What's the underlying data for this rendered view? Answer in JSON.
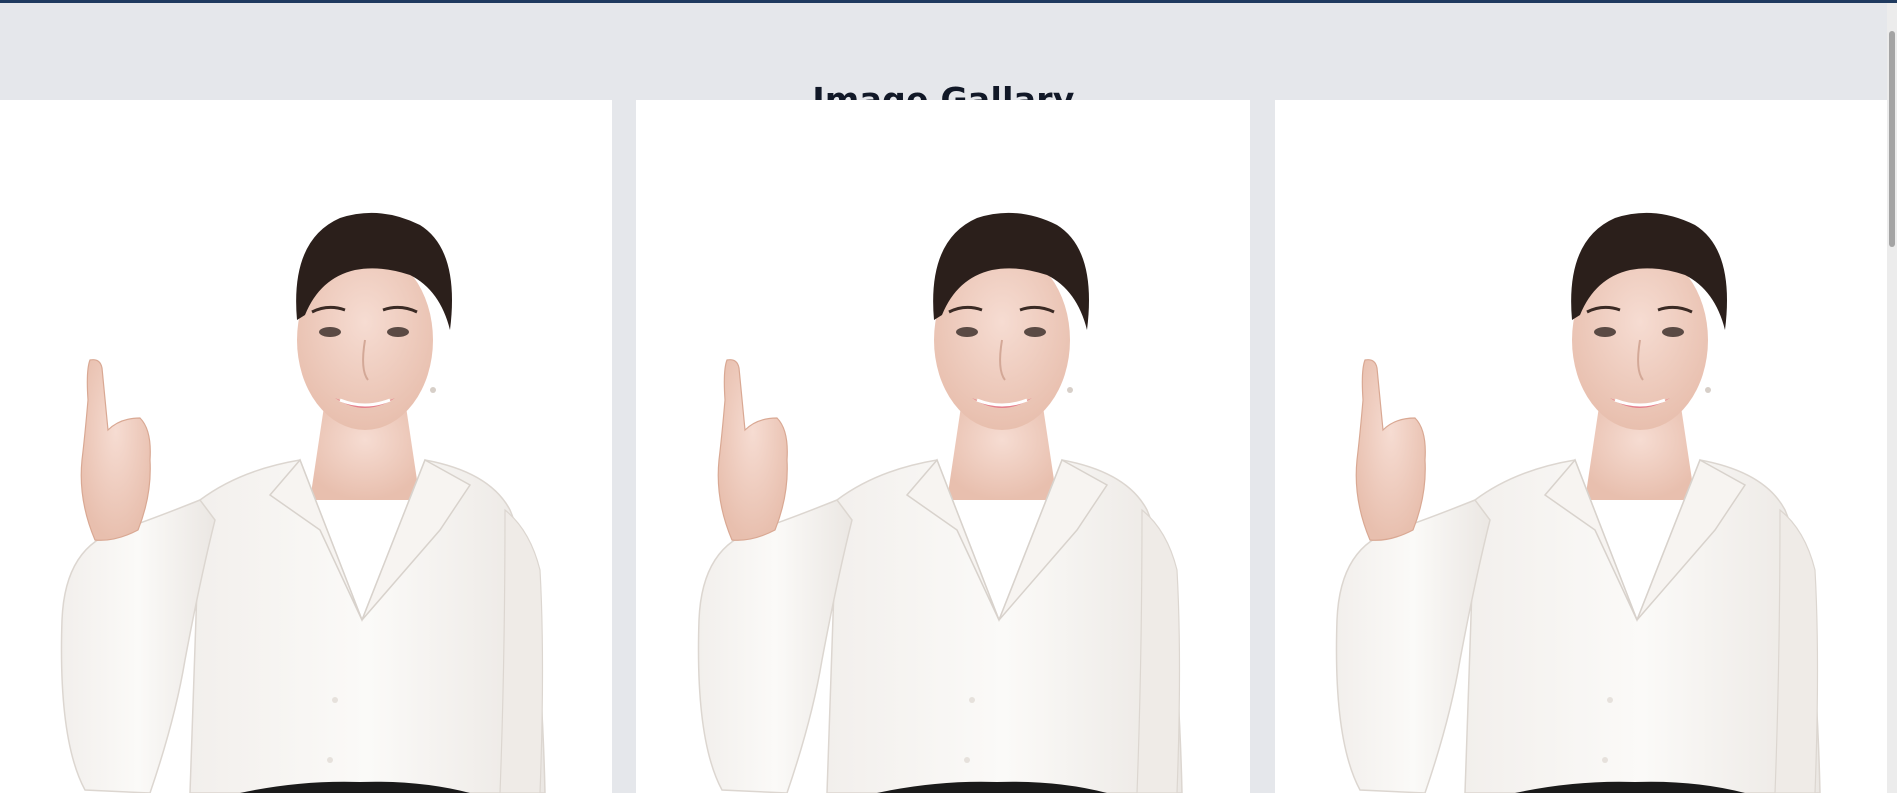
{
  "page": {
    "title": "Image Gallary"
  },
  "gallery": {
    "images": [
      {
        "subject": "woman-white-blouse-pointing-up"
      },
      {
        "subject": "woman-white-blouse-pointing-up"
      },
      {
        "subject": "woman-white-blouse-pointing-up"
      }
    ]
  },
  "colors": {
    "header_bar": "#1f3a5f",
    "background": "#e5e7eb",
    "card": "#ffffff"
  }
}
